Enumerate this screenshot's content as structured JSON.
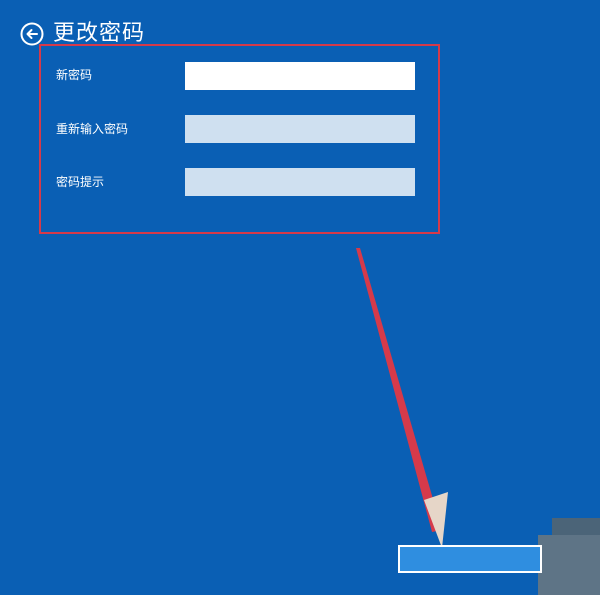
{
  "header": {
    "title": "更改密码",
    "back_icon": "arrow-left-circle-icon"
  },
  "form": {
    "fields": [
      {
        "label": "新密码",
        "value": "",
        "state": "active"
      },
      {
        "label": "重新输入密码",
        "value": "",
        "state": "inactive"
      },
      {
        "label": "密码提示",
        "value": "",
        "state": "inactive"
      }
    ]
  },
  "annotation": {
    "frame_color": "#d63a4a",
    "arrow_color": "#d63a4a"
  },
  "colors": {
    "background": "#0a5fb4",
    "field_active": "#ffffff",
    "field_inactive": "#cfe0f0"
  }
}
